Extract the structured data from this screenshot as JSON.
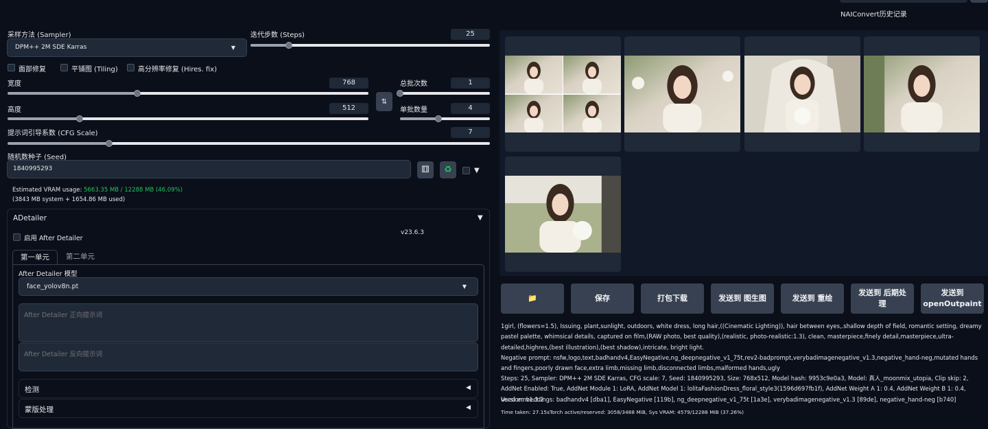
{
  "header": {
    "nai_history": "NAIConvert历史记录"
  },
  "sampler": {
    "label": "采样方法 (Sampler)",
    "value": "DPM++ 2M SDE Karras"
  },
  "steps": {
    "label": "迭代步数 (Steps)",
    "value": "25",
    "fraction": 0.16
  },
  "options": {
    "face_restore": "面部修复",
    "tiling": "平铺图 (Tiling)",
    "hires_fix": "高分辨率修复 (Hires. fix)"
  },
  "width": {
    "label": "宽度",
    "value": "768",
    "fraction": 0.36
  },
  "height": {
    "label": "高度",
    "value": "512",
    "fraction": 0.2
  },
  "batch_count": {
    "label": "总批次数",
    "value": "1",
    "fraction": 0.0
  },
  "batch_size": {
    "label": "单批数量",
    "value": "4",
    "fraction": 0.43
  },
  "cfg": {
    "label": "提示词引导系数 (CFG Scale)",
    "value": "7",
    "fraction": 0.21
  },
  "seed": {
    "label": "随机数种子 (Seed)",
    "value": "1840995293"
  },
  "vram": {
    "prefix": "Estimated VRAM usage: ",
    "highlight": "5663.35 MB / 12288 MB (46.09%)",
    "detail": "(3843 MB system + 1654.86 MB used)"
  },
  "adetailer": {
    "title": "ADetailer",
    "version": "v23.6.3",
    "enable_label": "启用 After Detailer",
    "tabs": [
      "第一单元",
      "第二单元"
    ],
    "model_label": "After Detailer 模型",
    "model_value": "face_yolov8n.pt",
    "pos_placeholder": "After Detailer 正向提示词",
    "neg_placeholder": "After Detailer 反向提示词",
    "sections": [
      "检测",
      "蒙版处理"
    ]
  },
  "actions": {
    "folder": "📁",
    "save": "保存",
    "zip": "打包下载",
    "to_img2img": "发送到 图生图",
    "to_inpaint": "发送到 重绘",
    "to_extras": "发送到 后期处\n理",
    "to_outpaint": "发送到\nopenOutpaint"
  },
  "info": {
    "prompt": "1girl, (flowers=1.5), Issuing, plant,sunlight, outdoors, white dress, long hair,((Cinematic Lighting)), hair between eyes,.shallow depth of field, romantic setting, dreamy pastel palette, whimsical details, captured on film,(RAW photo, best quality),(realistic, photo-realistic:1.3), clean, masterpiece,finely detail,masterpiece,ultra-detailed,highres,(best illustration),(best shadow),intricate, bright light.",
    "negative": "Negative prompt: nsfw,logo,text,badhandv4,EasyNegative,ng_deepnegative_v1_75t,rev2-badprompt,verybadimagenegative_v1.3,negative_hand-neg,mutated hands and fingers,poorly drawn face,extra limb,missing limb,disconnected limbs,malformed hands,ugly",
    "params": "Steps: 25, Sampler: DPM++ 2M SDE Karras, CFG scale: 7, Seed: 1840995293, Size: 768x512, Model hash: 9953c9e0a3, Model: 真人_moonmix_utopia, Clip skip: 2, AddNet Enabled: True, AddNet Module 1: LoRA, AddNet Model 1: lolitaFashionDress_floral_style3(1596d697fb1f), AddNet Weight A 1: 0.4, AddNet Weight B 1: 0.4, Version: v1.3.2",
    "embeddings": "Used embeddings: badhandv4 [dba1], EasyNegative [119b], ng_deepnegative_v1_75t [1a3e], verybadimagenegative_v1.3 [89de], negative_hand-neg [b740]",
    "time": "Time taken: 27.15sTorch active/reserved: 3058/3488 MiB, Sys VRAM: 4579/12288 MiB (37.26%)"
  },
  "colors": {
    "bg": "#0b0f19",
    "panel": "#1f2937",
    "button": "#374151",
    "vram_highlight": "#22c55e"
  }
}
